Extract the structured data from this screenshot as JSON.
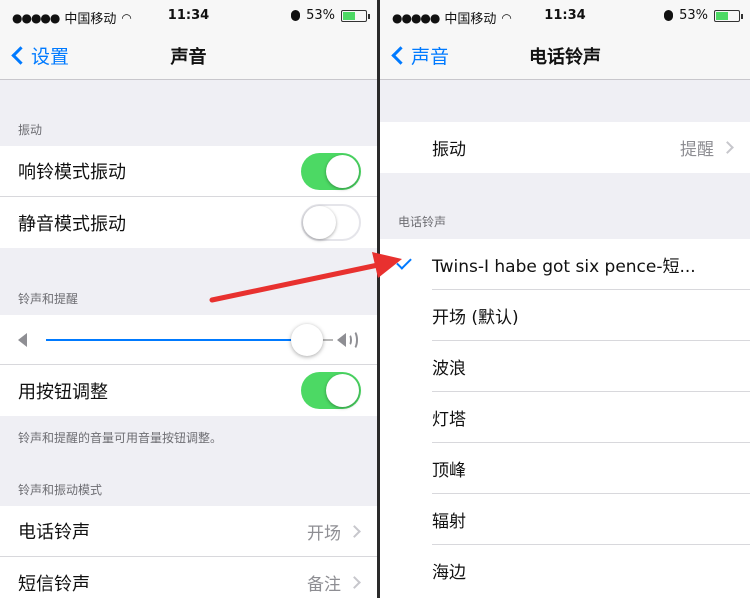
{
  "left": {
    "status": {
      "signal": "●●●●●",
      "carrier": "中国移动",
      "time": "11:34",
      "battery_pct": "53%",
      "battery_level": 0.53
    },
    "nav": {
      "back_label": "设置",
      "title": "声音"
    },
    "vibrate_section": {
      "header": "振动",
      "rows": [
        {
          "label": "响铃模式振动",
          "on": true
        },
        {
          "label": "静音模式振动",
          "on": false
        }
      ]
    },
    "ringer_section": {
      "header": "铃声和提醒",
      "volume_level": 0.86,
      "buttons_row": {
        "label": "用按钮调整",
        "on": true
      },
      "footer": "铃声和提醒的音量可用音量按钮调整。"
    },
    "patterns_section": {
      "header": "铃声和振动模式",
      "rows": [
        {
          "label": "电话铃声",
          "value": "开场"
        },
        {
          "label": "短信铃声",
          "value": "备注"
        }
      ]
    }
  },
  "right": {
    "status": {
      "signal": "●●●●●",
      "carrier": "中国移动",
      "time": "11:34",
      "battery_pct": "53%",
      "battery_level": 0.53
    },
    "nav": {
      "back_label": "声音",
      "title": "电话铃声"
    },
    "vibration_row": {
      "label": "振动",
      "value": "提醒"
    },
    "ringtone_header": "电话铃声",
    "selected_ringtone": "Twins-I habe got six pence-短...",
    "ringtones": [
      "开场 (默认)",
      "波浪",
      "灯塔",
      "顶峰",
      "辐射",
      "海边"
    ]
  },
  "colors": {
    "accent": "#007aff",
    "toggle_on": "#4cd964",
    "annotation_arrow": "#e8312f"
  }
}
